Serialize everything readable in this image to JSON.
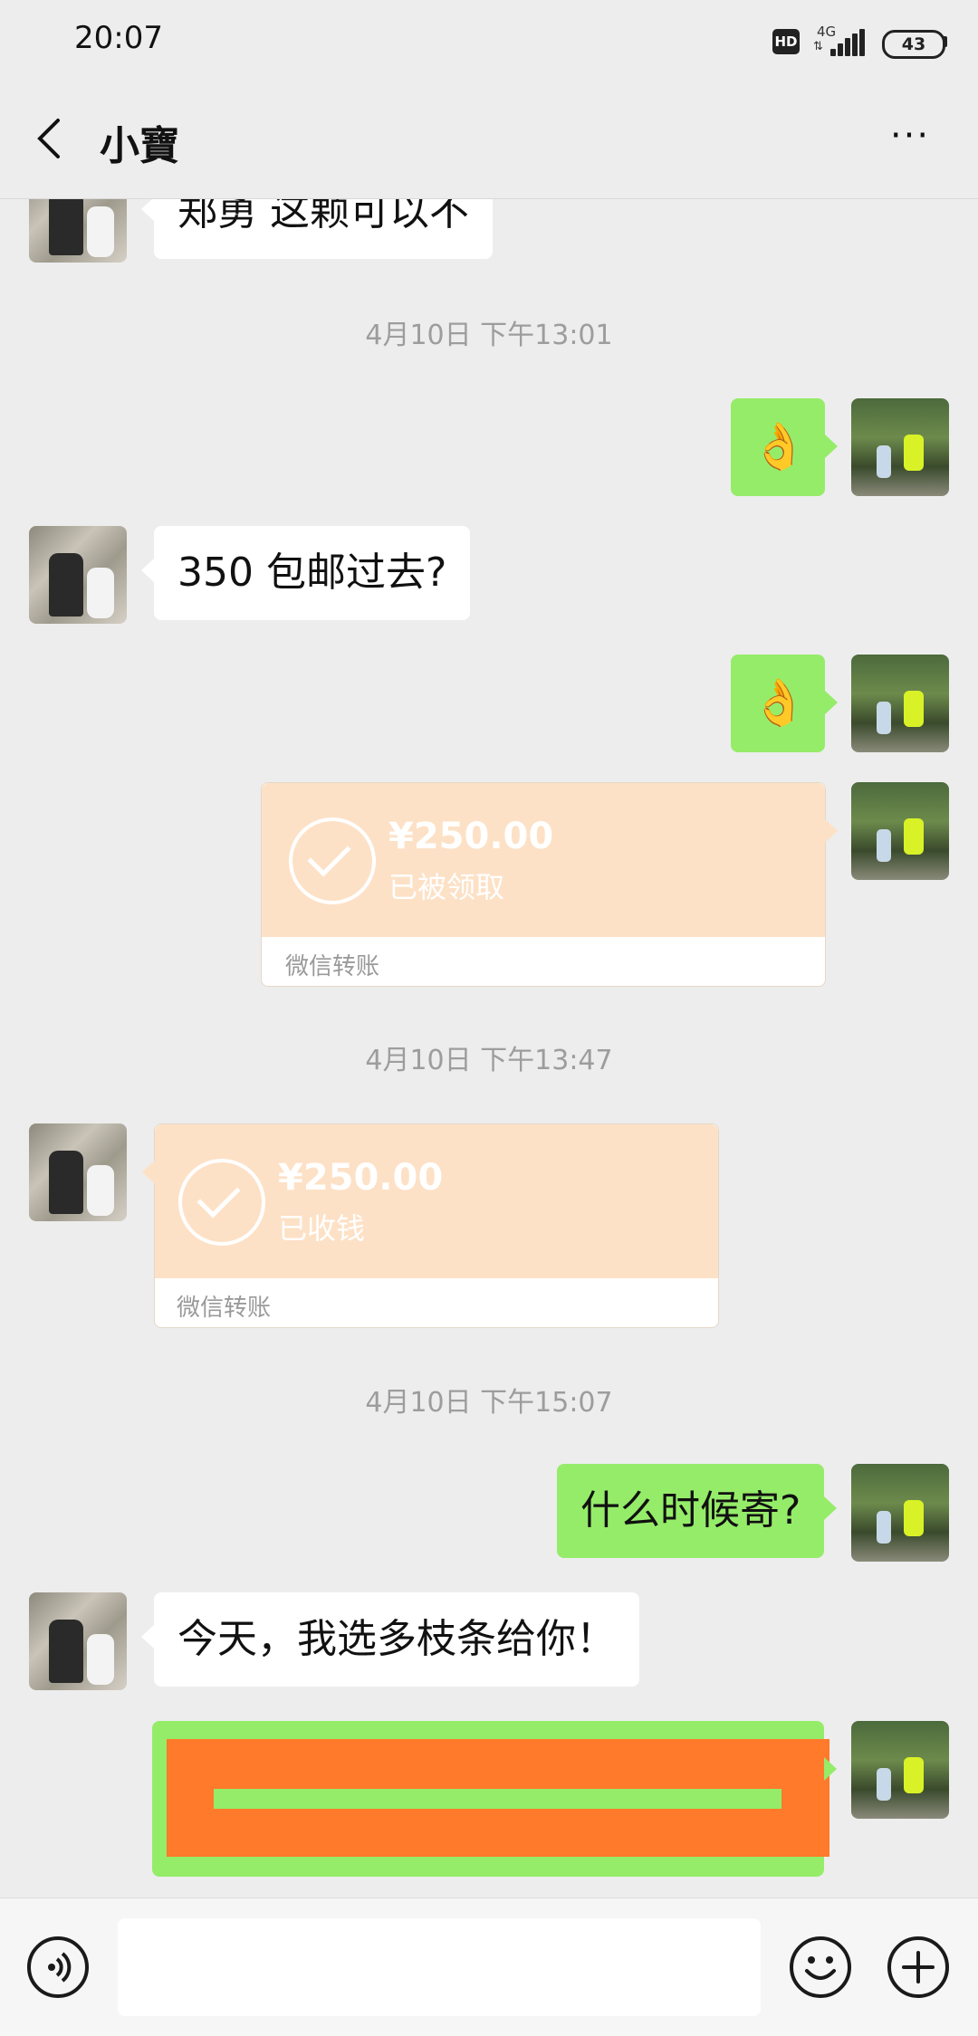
{
  "status_bar": {
    "time": "20:07",
    "hd": "HD",
    "network": "4G",
    "battery": "43"
  },
  "nav": {
    "title": "小寶",
    "more": "···"
  },
  "messages": {
    "m1": "郑勇  这颗可以不",
    "ts1": "4月10日 下午13:01",
    "m3": "350 包邮过去?",
    "transfer1": {
      "amount": "¥250.00",
      "status": "已被领取",
      "label": "微信转账"
    },
    "ts2": "4月10日 下午13:47",
    "transfer2": {
      "amount": "¥250.00",
      "status": "已收钱",
      "label": "微信转账"
    },
    "ts3": "4月10日 下午15:07",
    "m6": "什么时候寄?",
    "m7": "今天，我选多枝条给你！"
  },
  "emoji_name": "ok-hand-emoji",
  "input": {
    "value": ""
  }
}
